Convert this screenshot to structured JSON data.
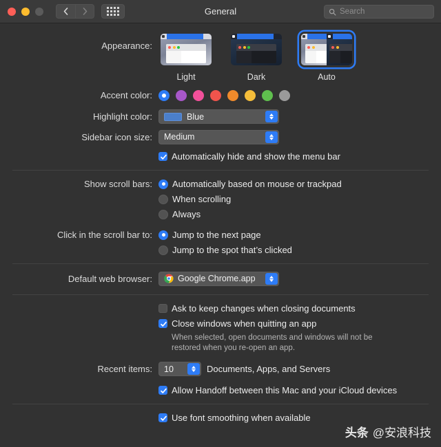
{
  "window": {
    "title": "General",
    "traffic_lights": [
      "close",
      "minimize",
      "zoom"
    ],
    "nav": {
      "back": "‹",
      "forward": "›",
      "grid": "show-all"
    },
    "search": {
      "placeholder": "Search",
      "value": ""
    }
  },
  "appearance": {
    "label": "Appearance:",
    "options": [
      {
        "id": "light",
        "title": "Light",
        "selected": false
      },
      {
        "id": "dark",
        "title": "Dark",
        "selected": false
      },
      {
        "id": "auto",
        "title": "Auto",
        "selected": true
      }
    ]
  },
  "accent_color": {
    "label": "Accent color:",
    "swatches": [
      {
        "name": "Blue",
        "hex": "#2e7cf6",
        "selected": true
      },
      {
        "name": "Purple",
        "hex": "#a martial"
      }
    ],
    "colors": [
      {
        "name": "Blue",
        "hex": "#2e7cf6",
        "selected": true
      },
      {
        "name": "Purple",
        "hex": "#a757c8",
        "selected": false
      },
      {
        "name": "Pink",
        "hex": "#f1509a",
        "selected": false
      },
      {
        "name": "Red",
        "hex": "#f0544c",
        "selected": false
      },
      {
        "name": "Orange",
        "hex": "#ef8a2b",
        "selected": false
      },
      {
        "name": "Yellow",
        "hex": "#f5bd3a",
        "selected": false
      },
      {
        "name": "Green",
        "hex": "#5fbf4e",
        "selected": false
      },
      {
        "name": "Graphite",
        "hex": "#9a9a9a",
        "selected": false
      }
    ]
  },
  "highlight_color": {
    "label": "Highlight color:",
    "value": "Blue",
    "swatch_hex": "#4b7fcb"
  },
  "sidebar_icon_size": {
    "label": "Sidebar icon size:",
    "value": "Medium"
  },
  "menu_bar": {
    "autohide_label": "Automatically hide and show the menu bar",
    "autohide_checked": true
  },
  "scroll_bars": {
    "label": "Show scroll bars:",
    "options": [
      {
        "label": "Automatically based on mouse or trackpad",
        "selected": true
      },
      {
        "label": "When scrolling",
        "selected": false
      },
      {
        "label": "Always",
        "selected": false
      }
    ]
  },
  "click_scroll_bar": {
    "label": "Click in the scroll bar to:",
    "options": [
      {
        "label": "Jump to the next page",
        "selected": true
      },
      {
        "label": "Jump to the spot that’s clicked",
        "selected": false
      }
    ]
  },
  "default_browser": {
    "label": "Default web browser:",
    "value": "Google Chrome.app",
    "icon": "chrome-icon"
  },
  "documents": {
    "ask_keep_changes_label": "Ask to keep changes when closing documents",
    "ask_keep_changes_checked": false,
    "close_windows_label": "Close windows when quitting an app",
    "close_windows_checked": true,
    "help_text": "When selected, open documents and windows will not be restored when you re-open an app."
  },
  "recent_items": {
    "label": "Recent items:",
    "value": "10",
    "suffix": "Documents, Apps, and Servers"
  },
  "handoff": {
    "label": "Allow Handoff between this Mac and your iCloud devices",
    "checked": true
  },
  "font_smoothing": {
    "label": "Use font smoothing when available",
    "checked": true
  },
  "watermark": {
    "brand": "头条",
    "handle": "@安浪科技"
  }
}
